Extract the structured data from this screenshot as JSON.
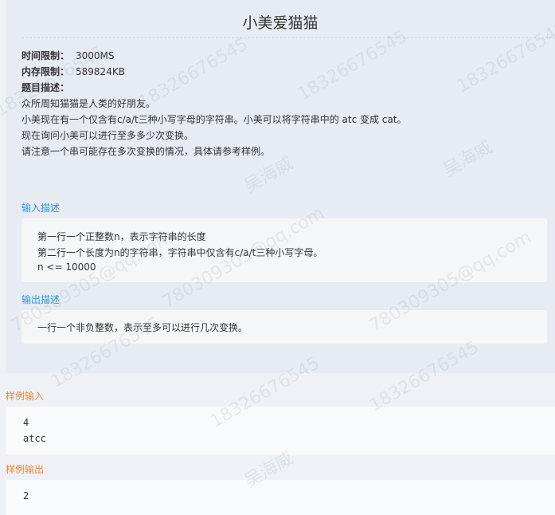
{
  "problem": {
    "title": "小美爱猫猫",
    "time_limit_label": "时间限制：",
    "time_limit": "3000MS",
    "memory_limit_label": "内存限制：",
    "memory_limit": "589824KB",
    "description_label": "题目描述：",
    "description": [
      "众所周知猫猫是人类的好朋友。",
      "小美现在有一个仅含有c/a/t三种小写字母的字符串。小美可以将字符串中的 atc 变成 cat。",
      "现在询问小美可以进行至多多少次变换。",
      "请注意一个串可能存在多次变换的情况，具体请参考样例。"
    ],
    "input_label": "输入描述",
    "input_lines": [
      "第一行一个正整数n，表示字符串的长度",
      "第二行一个长度为n的字符串，字符串中仅含有c/a/t三种小写字母。",
      "n <= 10000"
    ],
    "output_label": "输出描述",
    "output_lines": [
      "一行一个非负整数，表示至多可以进行几次变换。"
    ]
  },
  "sample": {
    "input_label": "样例输入",
    "input_lines": [
      "4",
      "atcc"
    ],
    "output_label": "样例输出",
    "output_lines": [
      "2"
    ]
  },
  "watermark": {
    "texts": [
      "18326676545",
      "吴海威",
      "780309305@qq.com"
    ]
  },
  "colors": {
    "section_label": "#2b9ad6",
    "sample_label": "#e8883a",
    "panel_bg": "#e6ecf2"
  }
}
